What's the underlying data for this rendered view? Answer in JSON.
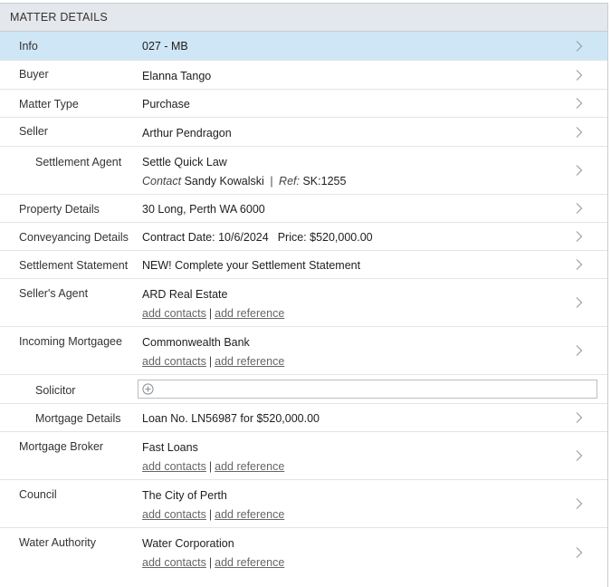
{
  "header": {
    "title": "MATTER DETAILS"
  },
  "rows": {
    "info": {
      "label": "Info",
      "value": "027 - MB"
    },
    "buyer": {
      "label": "Buyer",
      "value": "Elanna Tango"
    },
    "matter_type": {
      "label": "Matter Type",
      "value": "Purchase"
    },
    "seller": {
      "label": "Seller",
      "value": "Arthur Pendragon"
    },
    "settlement_agent": {
      "label": "Settlement Agent",
      "value": "Settle Quick Law",
      "contact_prefix": "Contact",
      "contact_name": "Sandy Kowalski",
      "separator": "|",
      "ref_prefix": "Ref:",
      "ref_value": "SK:1255"
    },
    "property_details": {
      "label": "Property Details",
      "value": "30 Long, Perth WA 6000"
    },
    "conveyancing_details": {
      "label": "Conveyancing Details",
      "contract_date": "Contract Date: 10/6/2024",
      "price": "Price: $520,000.00"
    },
    "settlement_statement": {
      "label": "Settlement Statement",
      "value": "NEW! Complete your Settlement Statement"
    },
    "sellers_agent": {
      "label": "Seller's Agent",
      "value": "ARD Real Estate",
      "add_contacts": "add contacts",
      "separator": "|",
      "add_reference": "add reference"
    },
    "incoming_mortgagee": {
      "label": "Incoming Mortgagee",
      "value": "Commonwealth Bank",
      "add_contacts": "add contacts",
      "separator": "|",
      "add_reference": "add reference"
    },
    "solicitor": {
      "label": "Solicitor",
      "value": ""
    },
    "mortgage_details": {
      "label": "Mortgage Details",
      "value": "Loan No. LN56987 for $520,000.00"
    },
    "mortgage_broker": {
      "label": "Mortgage Broker",
      "value": "Fast Loans",
      "add_contacts": "add contacts",
      "separator": "|",
      "add_reference": "add reference"
    },
    "council": {
      "label": "Council",
      "value": "The City of Perth",
      "add_contacts": "add contacts",
      "separator": "|",
      "add_reference": "add reference"
    },
    "water_authority": {
      "label": "Water Authority",
      "value": "Water Corporation",
      "add_contacts": "add contacts",
      "separator": "|",
      "add_reference": "add reference"
    }
  },
  "icons": {
    "row_chevron": "chevron-right-icon",
    "add": "plus-circle-icon"
  },
  "colors": {
    "selected_row": "#cfe6f7",
    "header_bg": "#e4e7eb"
  }
}
